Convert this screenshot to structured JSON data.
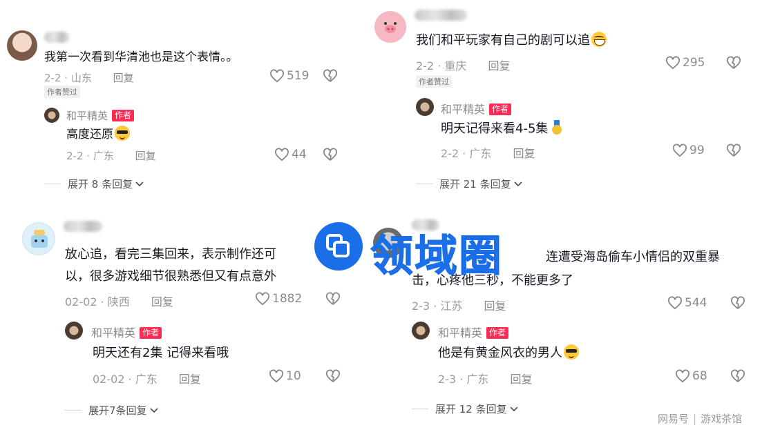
{
  "comments": [
    {
      "text": "我第一次看到华清池也是这个表情。。",
      "date": "2-2",
      "location": "山东",
      "reply_label": "回复",
      "likes": "519",
      "badge": "作者赞过",
      "author_reply": {
        "name": "和平精英",
        "author_badge": "作者",
        "text": "高度还原",
        "date": "2-2",
        "location": "广东",
        "reply_label": "回复",
        "likes": "44"
      },
      "expand": "展开 8 条回复"
    },
    {
      "text": "我们和平玩家有自己的剧可以追",
      "date": "2-2",
      "location": "重庆",
      "reply_label": "回复",
      "likes": "295",
      "badge": "作者赞过",
      "author_reply": {
        "name": "和平精英",
        "author_badge": "作者",
        "text": "明天记得来看4-5集",
        "date": "2-2",
        "location": "广东",
        "reply_label": "回复",
        "likes": "99"
      },
      "expand": "展开 21 条回复"
    },
    {
      "text_line1": "放心追，看完三集回来，表示制作还可",
      "text_line2": "以，很多游戏细节很熟悉但又有点意外",
      "date": "02-02",
      "location": "陕西",
      "reply_label": "回复",
      "likes": "1882",
      "author_reply": {
        "name": "和平精英",
        "author_badge": "作者",
        "text": "明天还有2集 记得来看哦",
        "date": "02-02",
        "location": "广东",
        "reply_label": "回复",
        "likes": "10"
      },
      "expand": "展开7条回复"
    },
    {
      "text_line1": "连遭受海岛偷车小情侣的双重暴",
      "text_line2": "击，心疼他三秒，不能更多了",
      "date": "2-3",
      "location": "江苏",
      "reply_label": "回复",
      "likes": "544",
      "author_reply": {
        "name": "和平精英",
        "author_badge": "作者",
        "text": "他是有黄金风衣的男人",
        "date": "2-3",
        "location": "广东",
        "reply_label": "回复",
        "likes": "68"
      },
      "expand": "展开 12 条回复"
    }
  ],
  "watermark": {
    "text": "领域圈"
  },
  "footer": {
    "source": "网易号",
    "account": "游戏茶馆"
  },
  "colors": {
    "author_badge": "#fe2c55",
    "watermark": "#1a6fe8",
    "meta_gray": "#9a9a9a"
  }
}
